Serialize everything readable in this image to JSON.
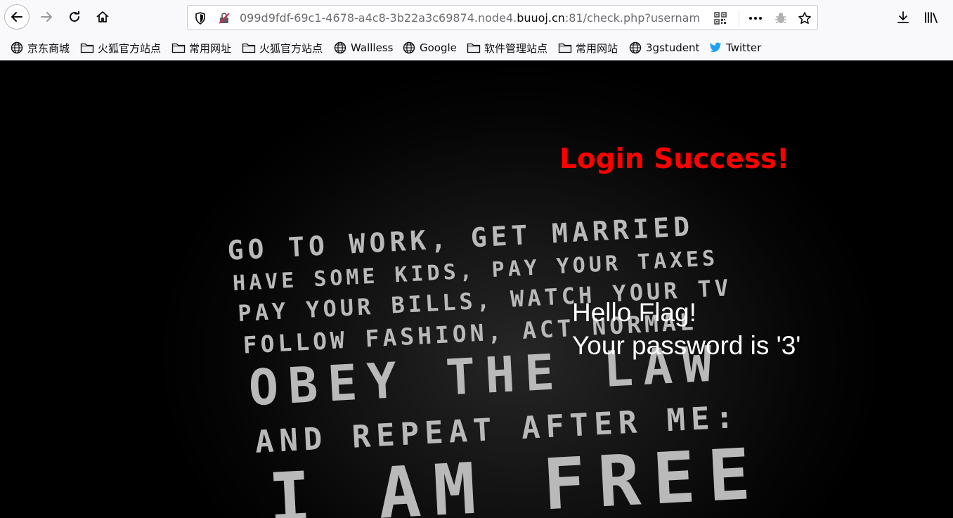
{
  "browser": {
    "url_prefix": "099d9fdf-69c1-4678-a4c8-3b22a3c69874.node4.",
    "url_domain": "buuoj.cn",
    "url_suffix": ":81/check.php?usernam"
  },
  "bookmarks": [
    {
      "label": "京东商城",
      "icon": "globe-icon"
    },
    {
      "label": "火狐官方站点",
      "icon": "folder-icon"
    },
    {
      "label": "常用网址",
      "icon": "folder-icon"
    },
    {
      "label": "火狐官方站点",
      "icon": "folder-icon"
    },
    {
      "label": "Wallless",
      "icon": "globe-icon"
    },
    {
      "label": "Google",
      "icon": "globe-icon"
    },
    {
      "label": "软件管理站点",
      "icon": "folder-icon"
    },
    {
      "label": "常用网站",
      "icon": "folder-icon"
    },
    {
      "label": "3gstudent",
      "icon": "globe-icon"
    },
    {
      "label": "Twitter",
      "icon": "twitter-icon"
    }
  ],
  "page": {
    "title": "Login Success!",
    "greeting": "Hello Flag!",
    "password_line": "Your password is '3'"
  },
  "poster": {
    "lines": [
      "GO TO WORK, GET MARRIED",
      "HAVE SOME KIDS, PAY YOUR TAXES",
      "PAY YOUR BILLS, WATCH YOUR TV",
      "FOLLOW FASHION, ACT NORMAL",
      "OBEY THE LAW",
      "AND REPEAT AFTER ME:",
      "I AM FREE"
    ]
  },
  "colors": {
    "title": "#ff0000",
    "text": "#ffffff",
    "background": "#000000"
  }
}
